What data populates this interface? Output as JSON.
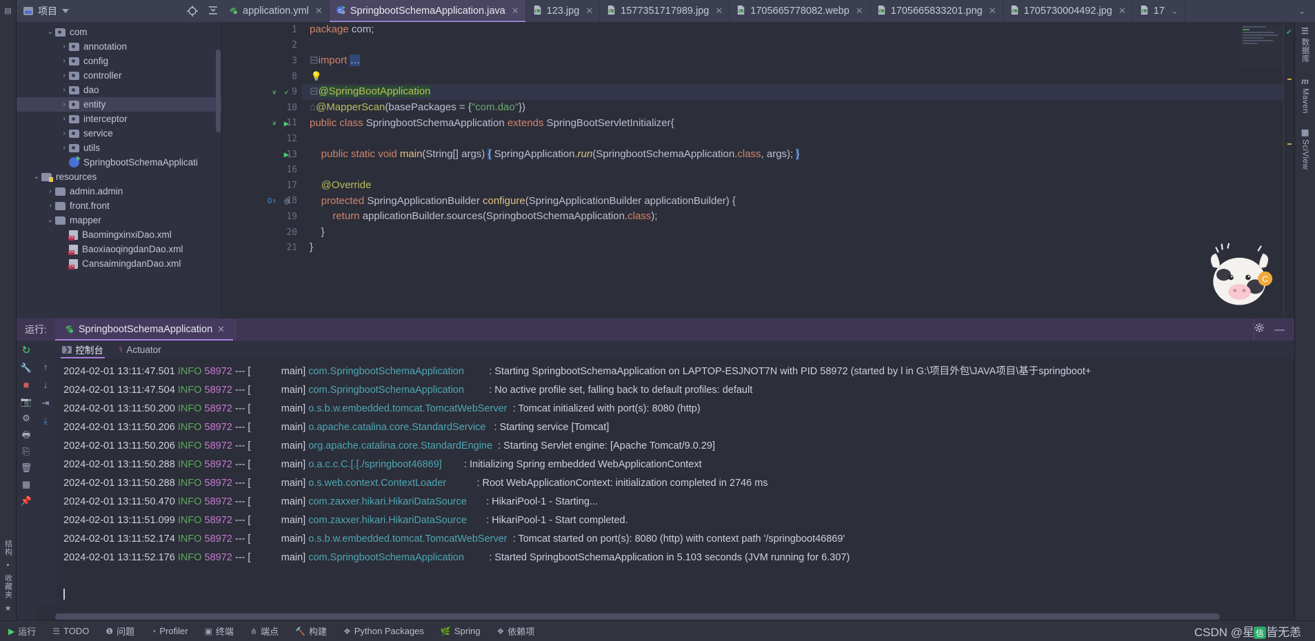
{
  "toolbar": {
    "project_label": "项目",
    "icons": [
      "locate-icon",
      "collapse-all-icon",
      "expand-all-icon",
      "settings-gear-icon",
      "minimize-icon"
    ]
  },
  "tabs": [
    {
      "label": "application.yml",
      "icon": "yaml-file-icon",
      "active": false
    },
    {
      "label": "SpringbootSchemaApplication.java",
      "icon": "spring-class-icon",
      "active": true
    },
    {
      "label": "123.jpg",
      "icon": "image-file-icon",
      "active": false
    },
    {
      "label": "1577351717989.jpg",
      "icon": "image-file-icon",
      "active": false
    },
    {
      "label": "1705665778082.webp",
      "icon": "image-file-icon",
      "active": false
    },
    {
      "label": "1705665833201.png",
      "icon": "image-file-icon",
      "active": false
    },
    {
      "label": "1705730004492.jpg",
      "icon": "image-file-icon",
      "active": false
    },
    {
      "label": "17",
      "icon": "image-file-icon",
      "active": false
    }
  ],
  "tree": [
    {
      "label": "com",
      "indent": 1,
      "arrow": "down",
      "icon": "package-folder",
      "selected": false
    },
    {
      "label": "annotation",
      "indent": 2,
      "arrow": "right",
      "icon": "package-folder",
      "selected": false
    },
    {
      "label": "config",
      "indent": 2,
      "arrow": "right",
      "icon": "package-folder",
      "selected": false
    },
    {
      "label": "controller",
      "indent": 2,
      "arrow": "right",
      "icon": "package-folder",
      "selected": false
    },
    {
      "label": "dao",
      "indent": 2,
      "arrow": "right",
      "icon": "package-folder",
      "selected": false
    },
    {
      "label": "entity",
      "indent": 2,
      "arrow": "right",
      "icon": "package-folder",
      "selected": true
    },
    {
      "label": "interceptor",
      "indent": 2,
      "arrow": "right",
      "icon": "package-folder",
      "selected": false
    },
    {
      "label": "service",
      "indent": 2,
      "arrow": "right",
      "icon": "package-folder",
      "selected": false
    },
    {
      "label": "utils",
      "indent": 2,
      "arrow": "right",
      "icon": "package-folder",
      "selected": false
    },
    {
      "label": "SpringbootSchemaApplicati",
      "indent": 2,
      "arrow": "none",
      "icon": "spring-class",
      "selected": false
    },
    {
      "label": "resources",
      "indent": 0,
      "arrow": "down",
      "icon": "resource-folder",
      "selected": false
    },
    {
      "label": "admin.admin",
      "indent": 1,
      "arrow": "right",
      "icon": "plain-folder",
      "selected": false
    },
    {
      "label": "front.front",
      "indent": 1,
      "arrow": "right",
      "icon": "plain-folder",
      "selected": false
    },
    {
      "label": "mapper",
      "indent": 1,
      "arrow": "down",
      "icon": "plain-folder",
      "selected": false
    },
    {
      "label": "BaomingxinxiDao.xml",
      "indent": 2,
      "arrow": "none",
      "icon": "xml-file",
      "selected": false
    },
    {
      "label": "BaoxiaoqingdanDao.xml",
      "indent": 2,
      "arrow": "none",
      "icon": "xml-file",
      "selected": false
    },
    {
      "label": "CansaimingdanDao.xml",
      "indent": 2,
      "arrow": "none",
      "icon": "xml-file",
      "selected": false
    }
  ],
  "editor": {
    "lines": [
      {
        "num": "1",
        "marks": "",
        "text_html": "<span class=\"kw\">package</span> com;"
      },
      {
        "num": "2",
        "marks": "",
        "text_html": ""
      },
      {
        "num": "3",
        "marks": "",
        "text_html": "<span class=\"fold\">⊟</span><span class=\"kw\">import</span> <span class=\"selbox\">…</span>"
      },
      {
        "num": "8",
        "marks": "bulb",
        "text_html": ""
      },
      {
        "num": "9",
        "marks": "spring-bean,verify",
        "text_html": "<span class=\"fold\">⊟</span><span class=\"ann hlbg\">@SpringBootApplication</span>"
      },
      {
        "num": "10",
        "marks": "",
        "text_html": "<span class=\"fold\">⌂</span><span class=\"ann\">@MapperScan</span>(basePackages = {<span class=\"str\">\"com.dao\"</span>})"
      },
      {
        "num": "11",
        "marks": "spring-bean,run",
        "text_html": "<span class=\"kw\">public class</span> SpringbootSchemaApplication <span class=\"kw\">extends</span> SpringBootServletInitializer{"
      },
      {
        "num": "12",
        "marks": "",
        "text_html": ""
      },
      {
        "num": "13",
        "marks": "run",
        "text_html": "    <span class=\"kw\">public static void</span> <span class=\"mth\">main</span>(String[] args) <span class=\"selbox\">{</span> SpringApplication.<span class=\"ital\">run</span>(SpringbootSchemaApplication.<span class=\"kw\">class</span>, args); <span class=\"selbox\">}</span>"
      },
      {
        "num": "16",
        "marks": "",
        "text_html": ""
      },
      {
        "num": "17",
        "marks": "",
        "text_html": "    <span class=\"ann\">@Override</span>"
      },
      {
        "num": "18",
        "marks": "override,at",
        "text_html": "    <span class=\"kw\">protected</span> SpringApplicationBuilder <span class=\"mth\">configure</span>(SpringApplicationBuilder applicationBuilder) {"
      },
      {
        "num": "19",
        "marks": "",
        "text_html": "        <span class=\"kw\">return</span> applicationBuilder.sources(SpringbootSchemaApplication.<span class=\"kw\">class</span>);"
      },
      {
        "num": "20",
        "marks": "",
        "text_html": "    }"
      },
      {
        "num": "21",
        "marks": "",
        "text_html": "}"
      }
    ]
  },
  "run_panel": {
    "label": "运行:",
    "tab_label": "SpringbootSchemaApplication",
    "console_tabs": [
      {
        "label": "控制台",
        "icon": "console-icon",
        "active": true
      },
      {
        "label": "Actuator",
        "icon": "actuator-icon",
        "active": false
      }
    ],
    "header_icons": [
      "settings-gear-icon",
      "minimize-icon"
    ],
    "rail_icons": [
      "rerun-icon",
      "build-icon",
      "stop-icon",
      "camera-icon",
      "thread-dump-icon",
      "print-icon",
      "export-icon",
      "trash-icon",
      "grid-icon",
      "pin-icon"
    ],
    "gutter_icons": [
      "scroll-up-icon",
      "scroll-down-icon",
      "soft-wrap-icon",
      "scroll-end-icon"
    ]
  },
  "console_log": [
    {
      "ts": "2024-02-01 13:11:47.501",
      "level": "INFO",
      "pid": "58972",
      "sep": "--- [",
      "thread": "main]",
      "logger": "com.SpringbootSchemaApplication",
      "lpad": 7,
      "msg": ": Starting SpringbootSchemaApplication on LAPTOP-ESJNOT7N with PID 58972 (started by l in G:\\项目外包\\JAVA项目\\基于springboot+"
    },
    {
      "ts": "2024-02-01 13:11:47.504",
      "level": "INFO",
      "pid": "58972",
      "sep": "--- [",
      "thread": "main]",
      "logger": "com.SpringbootSchemaApplication",
      "lpad": 7,
      "msg": ": No active profile set, falling back to default profiles: default"
    },
    {
      "ts": "2024-02-01 13:11:50.200",
      "level": "INFO",
      "pid": "58972",
      "sep": "--- [",
      "thread": "main]",
      "logger": "o.s.b.w.embedded.tomcat.TomcatWebServer",
      "lpad": 0,
      "msg": ": Tomcat initialized with port(s): 8080 (http)"
    },
    {
      "ts": "2024-02-01 13:11:50.206",
      "level": "INFO",
      "pid": "58972",
      "sep": "--- [",
      "thread": "main]",
      "logger": "o.apache.catalina.core.StandardService",
      "lpad": 1,
      "msg": ": Starting service [Tomcat]"
    },
    {
      "ts": "2024-02-01 13:11:50.206",
      "level": "INFO",
      "pid": "58972",
      "sep": "--- [",
      "thread": "main]",
      "logger": "org.apache.catalina.core.StandardEngine",
      "lpad": 0,
      "msg": ": Starting Servlet engine: [Apache Tomcat/9.0.29]"
    },
    {
      "ts": "2024-02-01 13:11:50.288",
      "level": "INFO",
      "pid": "58972",
      "sep": "--- [",
      "thread": "main]",
      "logger": "o.a.c.c.C.[.[./springboot46869]",
      "lpad": 6,
      "msg": ": Initializing Spring embedded WebApplicationContext"
    },
    {
      "ts": "2024-02-01 13:11:50.288",
      "level": "INFO",
      "pid": "58972",
      "sep": "--- [",
      "thread": "main]",
      "logger": "o.s.web.context.ContextLoader",
      "lpad": 9,
      "msg": ": Root WebApplicationContext: initialization completed in 2746 ms"
    },
    {
      "ts": "2024-02-01 13:11:50.470",
      "level": "INFO",
      "pid": "58972",
      "sep": "--- [",
      "thread": "main]",
      "logger": "com.zaxxer.hikari.HikariDataSource",
      "lpad": 5,
      "msg": ": HikariPool-1 - Starting..."
    },
    {
      "ts": "2024-02-01 13:11:51.099",
      "level": "INFO",
      "pid": "58972",
      "sep": "--- [",
      "thread": "main]",
      "logger": "com.zaxxer.hikari.HikariDataSource",
      "lpad": 5,
      "msg": ": HikariPool-1 - Start completed."
    },
    {
      "ts": "2024-02-01 13:11:52.174",
      "level": "INFO",
      "pid": "58972",
      "sep": "--- [",
      "thread": "main]",
      "logger": "o.s.b.w.embedded.tomcat.TomcatWebServer",
      "lpad": 0,
      "msg": ": Tomcat started on port(s): 8080 (http) with context path '/springboot46869'"
    },
    {
      "ts": "2024-02-01 13:11:52.176",
      "level": "INFO",
      "pid": "58972",
      "sep": "--- [",
      "thread": "main]",
      "logger": "com.SpringbootSchemaApplication",
      "lpad": 7,
      "msg": ": Started SpringbootSchemaApplication in 5.103 seconds (JVM running for 6.307)"
    }
  ],
  "status_bar": [
    {
      "label": "运行",
      "icon": "run-icon"
    },
    {
      "label": "TODO",
      "icon": "todo-icon"
    },
    {
      "label": "问题",
      "icon": "problems-icon"
    },
    {
      "label": "Profiler",
      "icon": "profiler-icon"
    },
    {
      "label": "终端",
      "icon": "terminal-icon"
    },
    {
      "label": "端点",
      "icon": "endpoints-icon"
    },
    {
      "label": "构建",
      "icon": "build-icon"
    },
    {
      "label": "Python Packages",
      "icon": "python-packages-icon"
    },
    {
      "label": "Spring",
      "icon": "spring-icon"
    },
    {
      "label": "依赖项",
      "icon": "dependencies-icon"
    }
  ],
  "watermark": "CSDN @星川皆无恙",
  "left_rail": [
    {
      "label": "结构",
      "icon": "structure-icon"
    },
    {
      "label": "收藏夹",
      "icon": "favorites-star-icon"
    }
  ],
  "right_rail": [
    {
      "label": "数据库",
      "icon": "database-icon"
    },
    {
      "label": "Maven",
      "icon": "maven-m-icon"
    },
    {
      "label": "SciView",
      "icon": "sciview-grid-icon"
    }
  ],
  "colors": {
    "accent_purple": "#a87fe0",
    "editor_bg": "#2c2e39",
    "panel_bg": "#2f3140",
    "toolbar_bg": "#3c3f51",
    "logger_cyan": "#4da8b5",
    "info_green": "#5fa85f",
    "pid_pink": "#c77ad4"
  }
}
